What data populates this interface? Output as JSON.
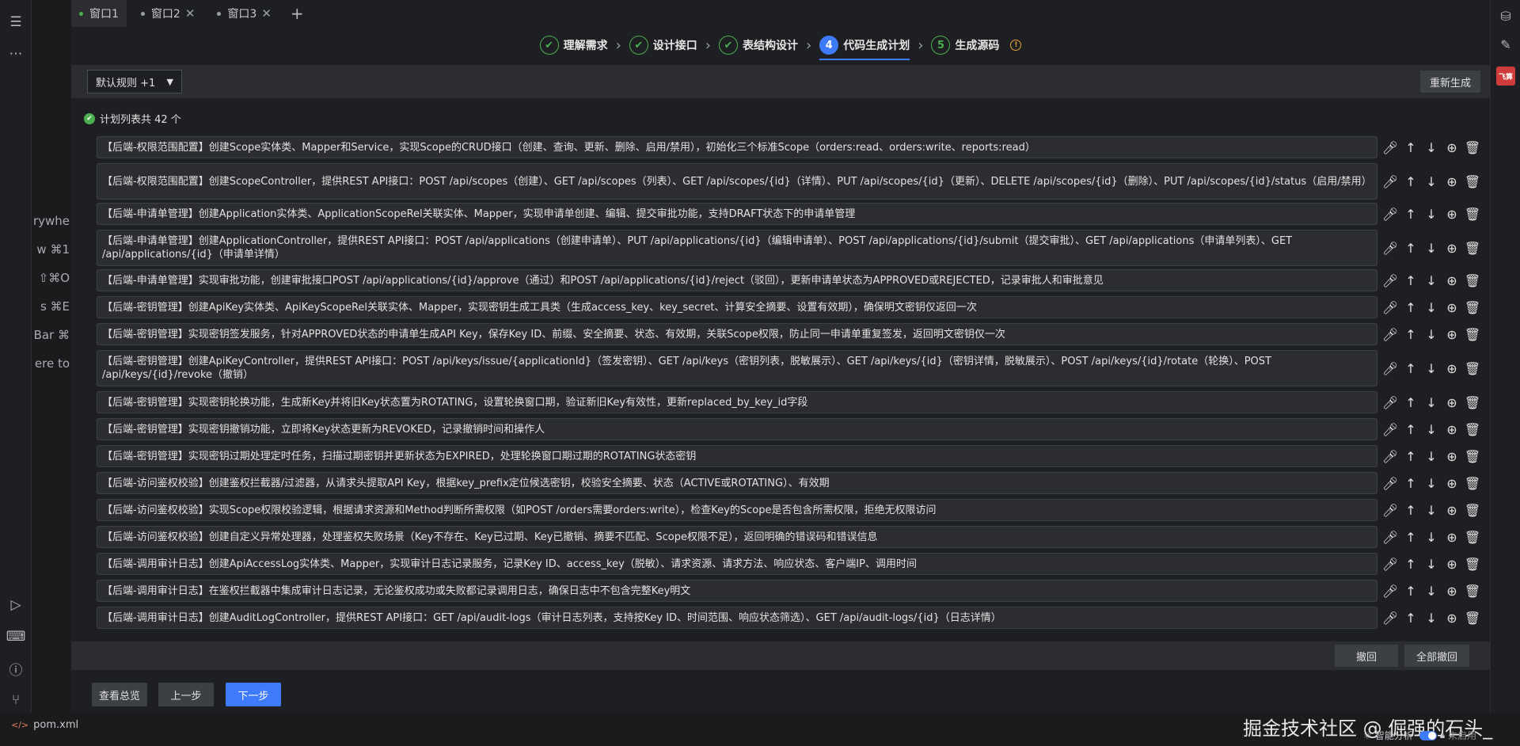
{
  "tabs": [
    {
      "label": "窗口1",
      "active": true,
      "closable": false
    },
    {
      "label": "窗口2",
      "active": false,
      "closable": true
    },
    {
      "label": "窗口3",
      "active": false,
      "closable": true
    }
  ],
  "stepper": {
    "steps": [
      {
        "num": "✔",
        "label": "理解需求",
        "state": "done"
      },
      {
        "num": "✔",
        "label": "设计接口",
        "state": "done"
      },
      {
        "num": "✔",
        "label": "表结构设计",
        "state": "done"
      },
      {
        "num": "4",
        "label": "代码生成计划",
        "state": "current"
      },
      {
        "num": "5",
        "label": "生成源码",
        "state": "pending"
      }
    ]
  },
  "toolbar": {
    "rule_select": "默认规则 +1",
    "regen_label": "重新生成"
  },
  "list": {
    "count_text": "计划列表共 42 个",
    "items": [
      "【后端-权限范围配置】创建Scope实体类、Mapper和Service，实现Scope的CRUD接口（创建、查询、更新、删除、启用/禁用），初始化三个标准Scope（orders:read、orders:write、reports:read）",
      "【后端-权限范围配置】创建ScopeController，提供REST API接口：POST /api/scopes（创建）、GET /api/scopes（列表）、GET /api/scopes/{id}（详情）、PUT /api/scopes/{id}（更新）、DELETE /api/scopes/{id}（删除）、PUT /api/scopes/{id}/status（启用/禁用）",
      "【后端-申请单管理】创建Application实体类、ApplicationScopeRel关联实体、Mapper，实现申请单创建、编辑、提交审批功能，支持DRAFT状态下的申请单管理",
      "【后端-申请单管理】创建ApplicationController，提供REST API接口：POST /api/applications（创建申请单）、PUT /api/applications/{id}（编辑申请单）、POST /api/applications/{id}/submit（提交审批）、GET /api/applications（申请单列表）、GET /api/applications/{id}（申请单详情）",
      "【后端-申请单管理】实现审批功能，创建审批接口POST /api/applications/{id}/approve（通过）和POST /api/applications/{id}/reject（驳回），更新申请单状态为APPROVED或REJECTED，记录审批人和审批意见",
      "【后端-密钥管理】创建ApiKey实体类、ApiKeyScopeRel关联实体、Mapper，实现密钥生成工具类（生成access_key、key_secret、计算安全摘要、设置有效期），确保明文密钥仅返回一次",
      "【后端-密钥管理】实现密钥签发服务，针对APPROVED状态的申请单生成API Key，保存Key ID、前缀、安全摘要、状态、有效期，关联Scope权限，防止同一申请单重复签发，返回明文密钥仅一次",
      "【后端-密钥管理】创建ApiKeyController，提供REST API接口：POST /api/keys/issue/{applicationId}（签发密钥）、GET /api/keys（密钥列表，脱敏展示）、GET /api/keys/{id}（密钥详情，脱敏展示）、POST /api/keys/{id}/rotate（轮换）、POST /api/keys/{id}/revoke（撤销）",
      "【后端-密钥管理】实现密钥轮换功能，生成新Key并将旧Key状态置为ROTATING，设置轮换窗口期，验证新旧Key有效性，更新replaced_by_key_id字段",
      "【后端-密钥管理】实现密钥撤销功能，立即将Key状态更新为REVOKED，记录撤销时间和操作人",
      "【后端-密钥管理】实现密钥过期处理定时任务，扫描过期密钥并更新状态为EXPIRED，处理轮换窗口期过期的ROTATING状态密钥",
      "【后端-访问鉴权校验】创建鉴权拦截器/过滤器，从请求头提取API Key，根据key_prefix定位候选密钥，校验安全摘要、状态（ACTIVE或ROTATING）、有效期",
      "【后端-访问鉴权校验】实现Scope权限校验逻辑，根据请求资源和Method判断所需权限（如POST /orders需要orders:write），检查Key的Scope是否包含所需权限，拒绝无权限访问",
      "【后端-访问鉴权校验】创建自定义异常处理器，处理鉴权失败场景（Key不存在、Key已过期、Key已撤销、摘要不匹配、Scope权限不足），返回明确的错误码和错误信息",
      "【后端-调用审计日志】创建ApiAccessLog实体类、Mapper，实现审计日志记录服务，记录Key ID、access_key（脱敏）、请求资源、请求方法、响应状态、客户端IP、调用时间",
      "【后端-调用审计日志】在鉴权拦截器中集成审计日志记录，无论鉴权成功或失败都记录调用日志，确保日志中不包含完整Key明文",
      "【后端-调用审计日志】创建AuditLogController，提供REST API接口：GET /api/audit-logs（审计日志列表，支持按Key ID、时间范围、响应状态筛选）、GET /api/audit-logs/{id}（日志详情）"
    ]
  },
  "undo_bar": {
    "undo_label": "撤回",
    "undo_all_label": "全部撤回"
  },
  "nav": {
    "overview_label": "查看总览",
    "prev_label": "上一步",
    "next_label": "下一步"
  },
  "ghost_text": [
    "rywhe",
    "w ⌘1",
    "⇧⌘O",
    "s ⌘E",
    "Bar ⌘",
    "ere to"
  ],
  "status": {
    "file": "pom.xml",
    "watermark": "掘金技术社区 @ 倔强的石头_",
    "smart_label": "智能分析",
    "unused_label": "未启用"
  },
  "right_badge": "飞算"
}
